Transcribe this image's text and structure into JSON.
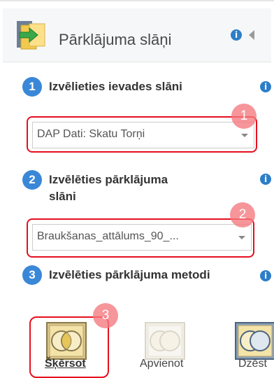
{
  "header": {
    "title": "Pārklājuma slāņi",
    "info_glyph": "i"
  },
  "steps": [
    {
      "number": "1",
      "label": "Izvēlieties ievades slāni",
      "select_value": "DAP Dati: Skatu Torņi",
      "marker": "1"
    },
    {
      "number": "2",
      "label_line1": "Izvēlēties pārklājuma",
      "label_line2": "slāni",
      "select_value": "Braukšanas_attālums_90_...",
      "marker": "2"
    },
    {
      "number": "3",
      "label": "Izvēlēties pārklājuma metodi",
      "marker": "3"
    }
  ],
  "methods": [
    {
      "label": "Šķērsot",
      "selected": true
    },
    {
      "label": "Apvienot",
      "selected": false
    },
    {
      "label": "Dzēst",
      "selected": false
    }
  ],
  "colors": {
    "accent": "#3a87d8",
    "highlight": "#e60f1e",
    "marker": "#f4787d"
  }
}
